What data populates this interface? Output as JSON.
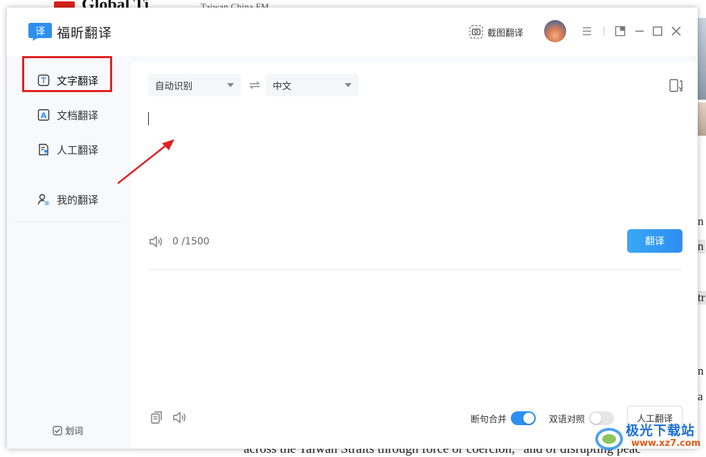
{
  "background_page": {
    "site_title": "Global Ti",
    "headline": "Taiwan  China  FM  ...",
    "right_chars": [
      "n",
      "n",
      "tr",
      "n",
      "a",
      "ta"
    ],
    "bottom_line": "across the Taiwan Straits through force or coercion,\" and of disrupting peac"
  },
  "app": {
    "name": "福昕翻译",
    "logo_glyph": "译",
    "screenshot_translate": "截图翻译"
  },
  "sidebar": {
    "items": [
      {
        "label": "文字翻译",
        "icon": "text-translate-icon",
        "glyph": "T",
        "active": true
      },
      {
        "label": "文档翻译",
        "icon": "document-translate-icon",
        "glyph": "A",
        "active": false
      },
      {
        "label": "人工翻译",
        "icon": "human-translate-icon",
        "glyph": "",
        "active": false
      },
      {
        "label": "我的翻译",
        "icon": "my-translate-icon",
        "glyph": "",
        "active": false
      }
    ],
    "huaci_label": "划词"
  },
  "translator": {
    "source_lang": "自动识别",
    "target_lang": "中文",
    "swap_symbol": "⇌",
    "input_value": "",
    "char_count": "0 /1500",
    "translate_button": "翻译",
    "sentence_merge_label": "断句合并",
    "sentence_merge_on": true,
    "bilingual_label": "双语对照",
    "bilingual_on": false,
    "human_translate_button": "人工翻译"
  },
  "watermark": {
    "text": "极光下载站",
    "url": "www.xz7.com"
  },
  "colors": {
    "accent": "#2d8ff0",
    "highlight_border": "#e02020",
    "arrow": "#e02020"
  }
}
